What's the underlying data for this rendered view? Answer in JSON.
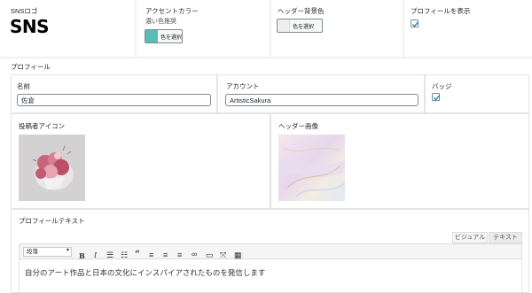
{
  "top": {
    "sns_logo_label": "SNSロゴ",
    "sns_logo_text": "SNS",
    "accent_label": "アクセントカラー",
    "accent_sub": "濃い色推奨",
    "accent_button": "色を選択",
    "accent_color": "#5bbdb5",
    "header_bg_label": "ヘッダー背景色",
    "header_bg_button": "色を選択",
    "header_bg_color": "#eeeeee",
    "show_profile_label": "プロフィールを表示",
    "show_profile_checked": true
  },
  "profile": {
    "section_label": "プロフィール",
    "name_label": "名前",
    "name_value": "佐倉",
    "account_label": "アカウント",
    "account_value": "ArtisticSakura",
    "badge_label": "バッジ",
    "badge_checked": true,
    "poster_icon_label": "投稿者アイコン",
    "header_image_label": "ヘッダー画像",
    "profile_text_label": "プロフィールテキスト"
  },
  "editor": {
    "tab_visual": "ビジュアル",
    "tab_text": "テキスト",
    "format_select": "段落",
    "content": "自分のアート作品と日本の文化にインスパイアされたものを発信します",
    "toolbar": [
      "bold-icon",
      "italic-icon",
      "bullet-list-icon",
      "numbered-list-icon",
      "blockquote-icon",
      "align-left-icon",
      "align-center-icon",
      "align-right-icon",
      "link-icon",
      "read-more-icon",
      "fullscreen-icon",
      "toolbar-toggle-icon"
    ]
  }
}
